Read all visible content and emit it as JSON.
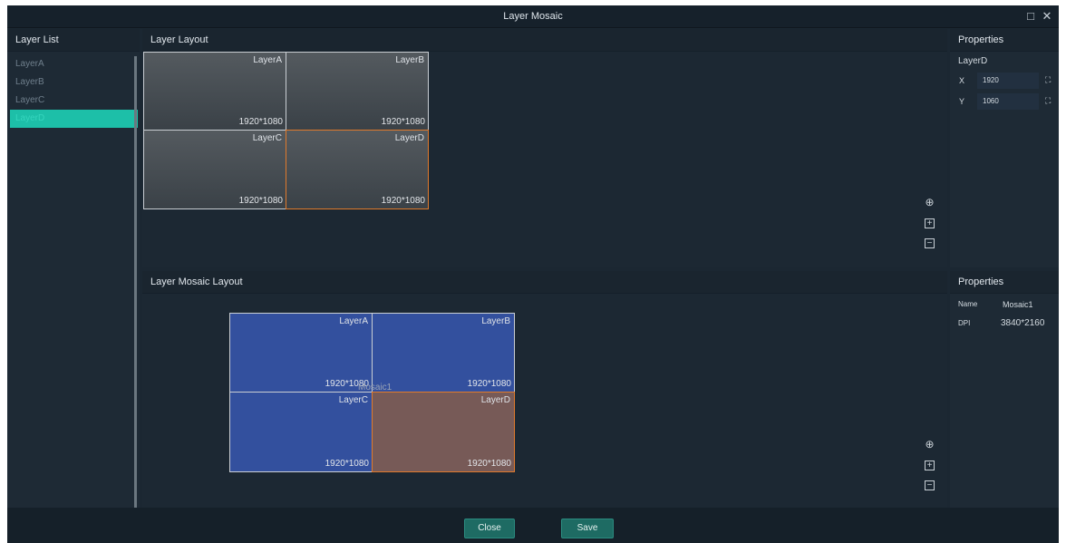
{
  "window": {
    "title": "Layer Mosaic",
    "maximize_icon": "□",
    "close_icon": "✕"
  },
  "layer_list": {
    "header": "Layer List",
    "items": [
      {
        "label": "LayerA",
        "selected": false
      },
      {
        "label": "LayerB",
        "selected": false
      },
      {
        "label": "LayerC",
        "selected": false
      },
      {
        "label": "LayerD",
        "selected": true
      }
    ]
  },
  "layer_layout": {
    "header": "Layer Layout",
    "cells": [
      {
        "name": "LayerA",
        "resolution": "1920*1080"
      },
      {
        "name": "LayerB",
        "resolution": "1920*1080"
      },
      {
        "name": "LayerC",
        "resolution": "1920*1080"
      },
      {
        "name": "LayerD",
        "resolution": "1920*1080"
      }
    ]
  },
  "mosaic_layout": {
    "header": "Layer Mosaic Layout",
    "mosaic_label": "Mosaic1",
    "cells": [
      {
        "name": "LayerA",
        "resolution": "1920*1080"
      },
      {
        "name": "LayerB",
        "resolution": "1920*1080"
      },
      {
        "name": "LayerC",
        "resolution": "1920*1080"
      },
      {
        "name": "LayerD",
        "resolution": "1920*1080"
      }
    ]
  },
  "tools": {
    "center_icon": "⊕",
    "zoom_in_icon": "+",
    "zoom_out_icon": "−"
  },
  "properties_top": {
    "header": "Properties",
    "layer_name": "LayerD",
    "x_label": "X",
    "x_value": "1920",
    "y_label": "Y",
    "y_value": "1060",
    "link_icon": "⛶"
  },
  "properties_bottom": {
    "header": "Properties",
    "name_label": "Name",
    "name_value": "Mosaic1",
    "dpi_label": "DPI",
    "dpi_value": "3840*2160"
  },
  "footer": {
    "close_label": "Close",
    "save_label": "Save"
  },
  "colors": {
    "accent": "#1dbfa8",
    "selected_border": "#e07a2c",
    "mosaic_blue": "#33509e"
  }
}
